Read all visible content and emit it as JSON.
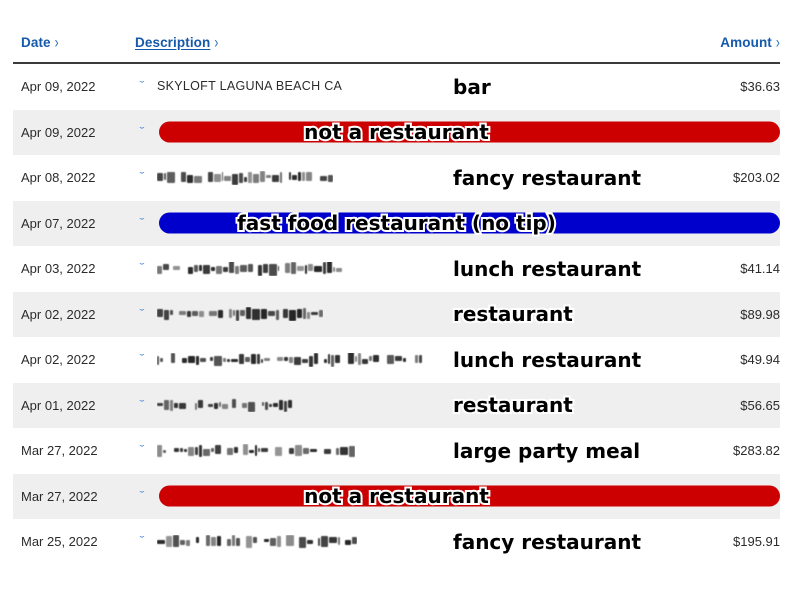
{
  "table": {
    "columns": [
      {
        "key": "date",
        "label": "Date",
        "sort_chevron": "›",
        "underlined": false,
        "align": "left"
      },
      {
        "key": "description",
        "label": "Description",
        "sort_chevron": "›",
        "underlined": true,
        "align": "left"
      },
      {
        "key": "amount",
        "label": "Amount",
        "sort_chevron": "›",
        "underlined": false,
        "align": "right"
      }
    ],
    "expand_icon": "chevron-down-icon",
    "expand_glyph": "ˇ",
    "rows": [
      {
        "date": "Apr 09, 2022",
        "description": "SKYLOFT LAGUNA BEACH CA",
        "description_state": "visible",
        "amount": "$36.63",
        "amount_state": "visible",
        "annotation": "bar",
        "annotation_style": "mid"
      },
      {
        "date": "Apr 09, 2022",
        "description": "",
        "description_state": "pill",
        "amount": "",
        "amount_state": "pill",
        "pill_color": "#cc0000",
        "annotation": "not a restaurant",
        "annotation_style": "center"
      },
      {
        "date": "Apr 08, 2022",
        "description": "",
        "description_state": "scrambled",
        "scramble_width": 176,
        "amount": "$203.02",
        "amount_state": "visible",
        "annotation": "fancy restaurant",
        "annotation_style": "mid"
      },
      {
        "date": "Apr 07, 2022",
        "description": "",
        "description_state": "pill",
        "amount": "",
        "amount_state": "pill",
        "pill_color": "#0000cc",
        "annotation": "fast food restaurant (no tip)",
        "annotation_style": "center"
      },
      {
        "date": "Apr 03, 2022",
        "description": "",
        "description_state": "scrambled",
        "scramble_width": 190,
        "amount": "$41.14",
        "amount_state": "visible",
        "annotation": "lunch restaurant",
        "annotation_style": "mid"
      },
      {
        "date": "Apr 02, 2022",
        "description": "",
        "description_state": "scrambled",
        "scramble_width": 166,
        "amount": "$89.98",
        "amount_state": "visible",
        "annotation": "restaurant",
        "annotation_style": "mid"
      },
      {
        "date": "Apr 02, 2022",
        "description": "",
        "description_state": "scrambled",
        "scramble_width": 272,
        "amount": "$49.94",
        "amount_state": "visible",
        "annotation": "lunch restaurant",
        "annotation_style": "mid"
      },
      {
        "date": "Apr 01, 2022",
        "description": "",
        "description_state": "scrambled",
        "scramble_width": 140,
        "amount": "$56.65",
        "amount_state": "visible",
        "annotation": "restaurant",
        "annotation_style": "mid"
      },
      {
        "date": "Mar 27, 2022",
        "description": "",
        "description_state": "scrambled",
        "scramble_width": 198,
        "amount": "$283.82",
        "amount_state": "visible",
        "annotation": "large party meal",
        "annotation_style": "mid"
      },
      {
        "date": "Mar 27, 2022",
        "description": "",
        "description_state": "pill",
        "amount": "",
        "amount_state": "pill",
        "pill_color": "#cc0000",
        "annotation": "not a restaurant",
        "annotation_style": "center"
      },
      {
        "date": "Mar 25, 2022",
        "description": "",
        "description_state": "scrambled",
        "scramble_width": 200,
        "amount": "$195.91",
        "amount_state": "visible",
        "annotation": "fancy restaurant",
        "annotation_style": "mid"
      }
    ]
  },
  "colors": {
    "header_link": "#1559ab",
    "row_stripe": "#efeff0",
    "row_base": "#ffffff",
    "redact_red": "#cc0000",
    "redact_blue": "#0000cc",
    "text": "#2b2b2b",
    "chevron": "#3d7fd0"
  }
}
